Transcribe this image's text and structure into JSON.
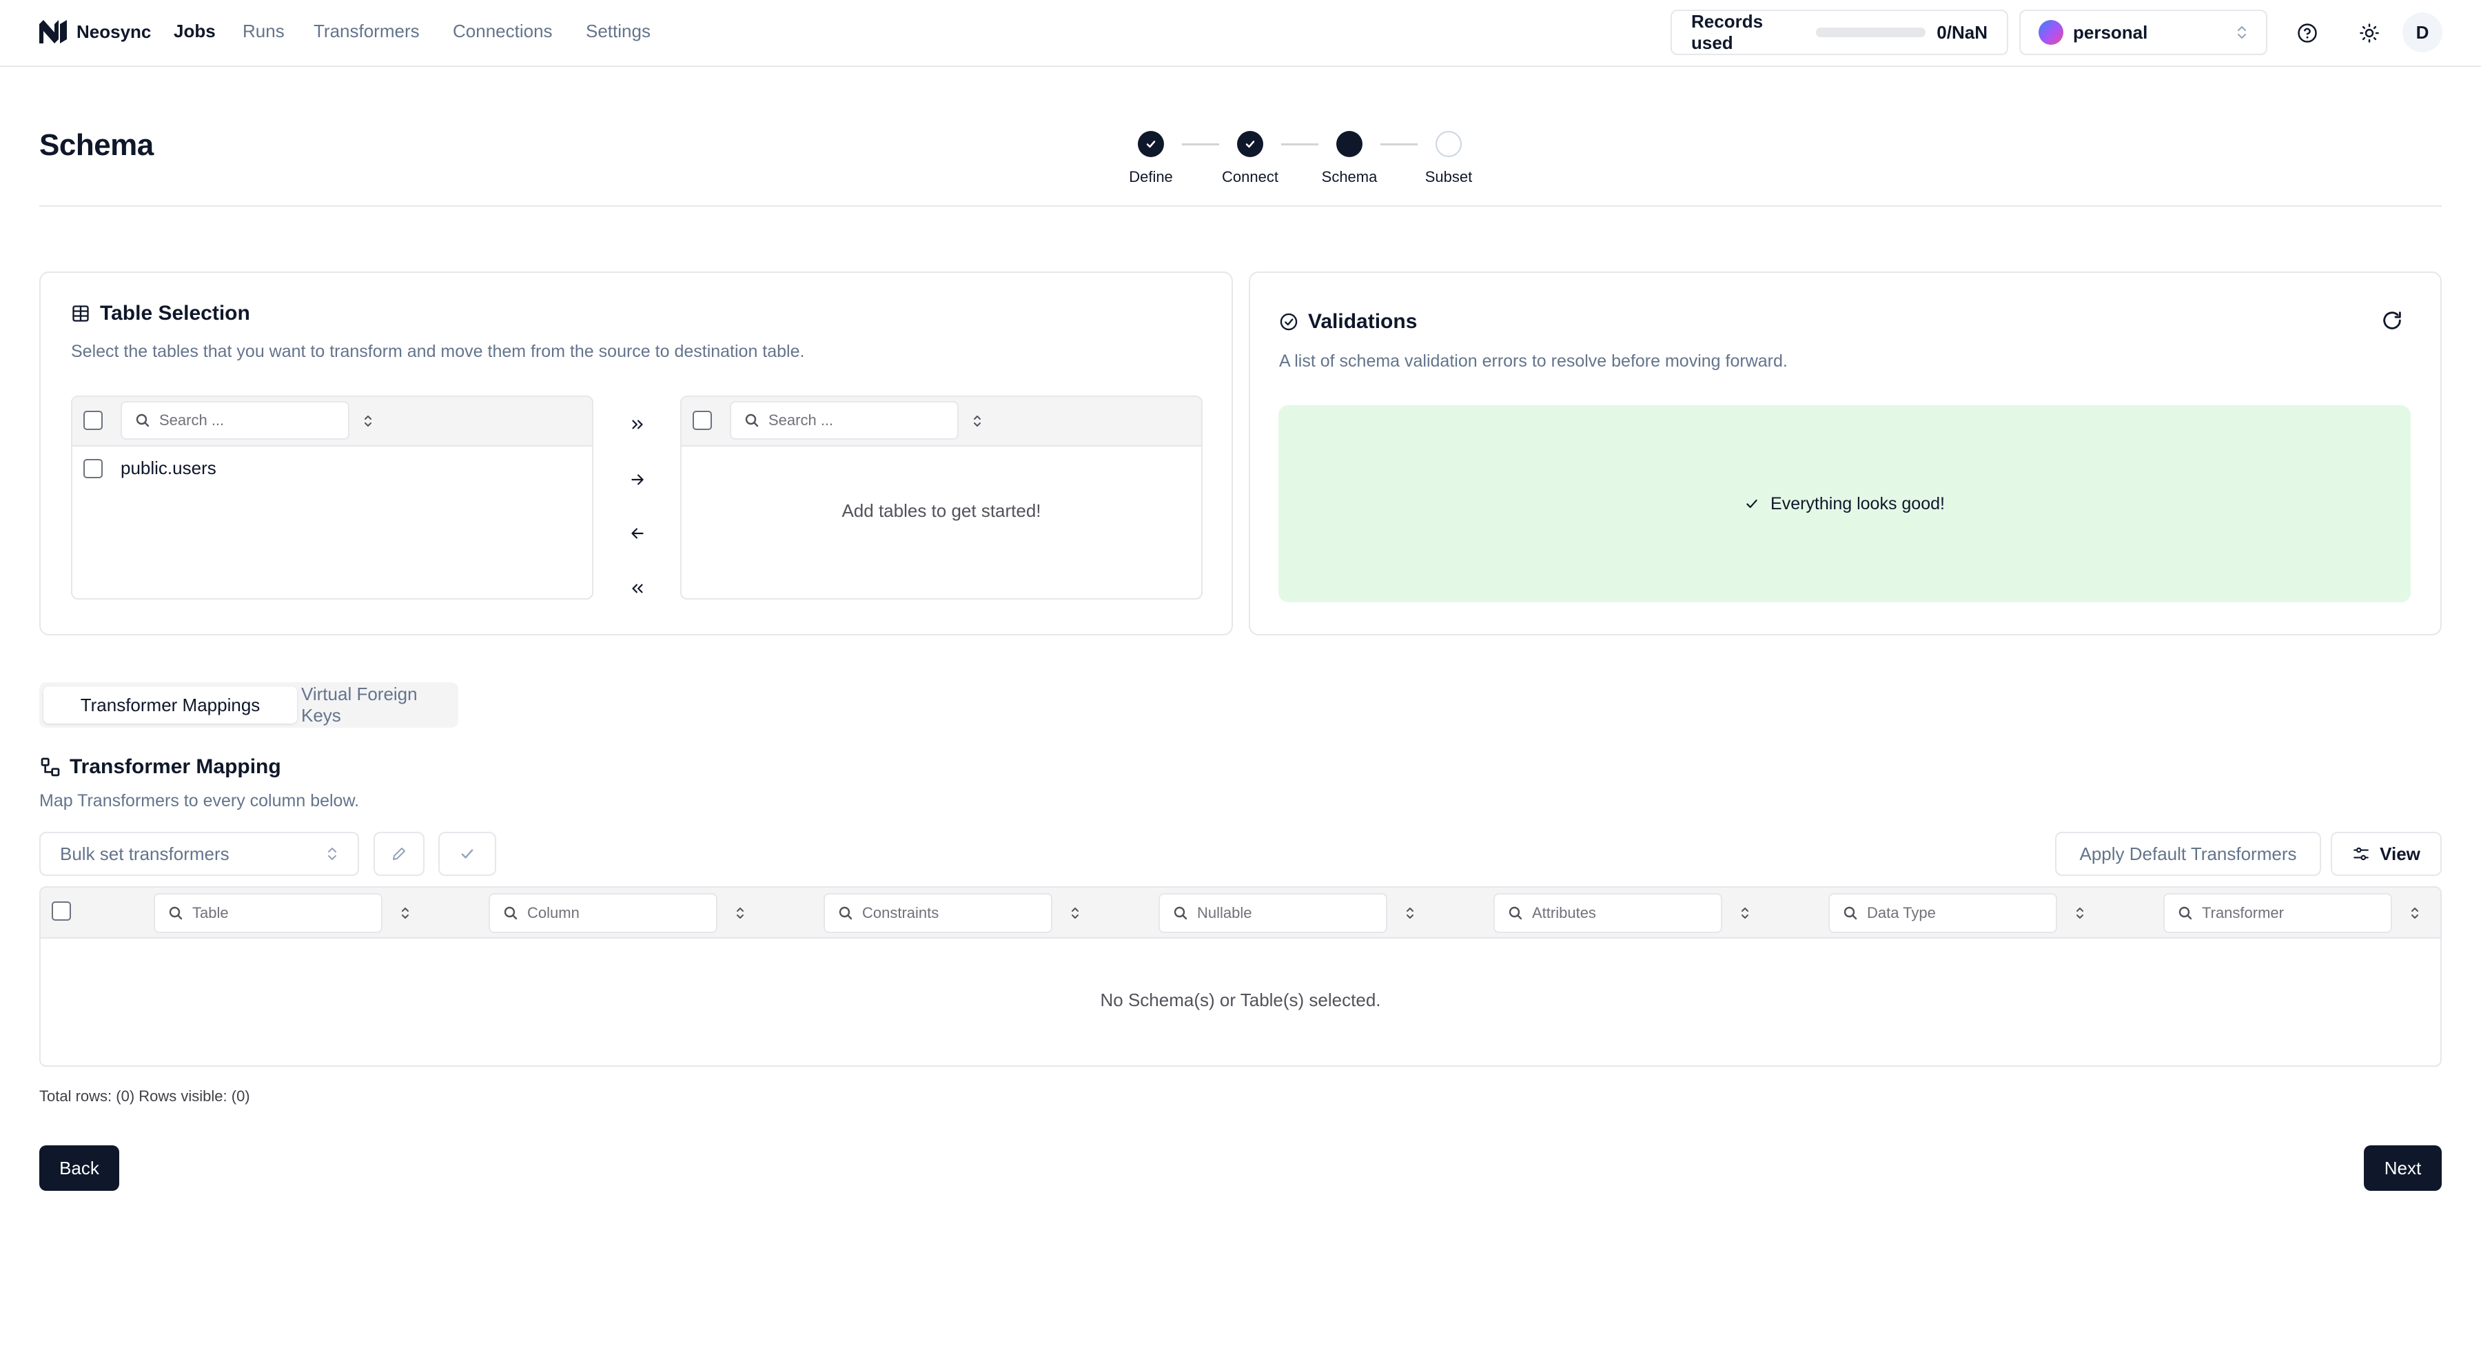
{
  "nav": {
    "brand": "Neosync",
    "links": [
      "Jobs",
      "Runs",
      "Transformers",
      "Connections",
      "Settings"
    ],
    "active_link": "Jobs"
  },
  "records": {
    "label": "Records used",
    "value": "0/NaN",
    "progress_fraction": 0
  },
  "account": {
    "name": "personal"
  },
  "user": {
    "initial": "D"
  },
  "page": {
    "title": "Schema"
  },
  "stepper": {
    "steps": [
      {
        "label": "Define",
        "state": "done"
      },
      {
        "label": "Connect",
        "state": "done"
      },
      {
        "label": "Schema",
        "state": "current"
      },
      {
        "label": "Subset",
        "state": "todo"
      }
    ]
  },
  "table_selection": {
    "title": "Table Selection",
    "description": "Select the tables that you want to transform and move them from the source to destination table.",
    "source": {
      "search_placeholder": "Search ...",
      "items": [
        "public.users"
      ]
    },
    "destination": {
      "search_placeholder": "Search ...",
      "empty_text": "Add tables to get started!"
    }
  },
  "validations": {
    "title": "Validations",
    "description": "A list of schema validation errors to resolve before moving forward.",
    "status_text": "Everything looks good!"
  },
  "tabs": {
    "items": [
      "Transformer Mappings",
      "Virtual Foreign Keys"
    ],
    "active": "Transformer Mappings"
  },
  "mapping": {
    "title": "Transformer Mapping",
    "description": "Map Transformers to every column below.",
    "bulk_placeholder": "Bulk set transformers",
    "apply_default_label": "Apply Default Transformers",
    "view_label": "View",
    "columns": [
      "Table",
      "Column",
      "Constraints",
      "Nullable",
      "Attributes",
      "Data Type",
      "Transformer"
    ],
    "empty_text": "No Schema(s) or Table(s) selected.",
    "footer": "Total rows: (0) Rows visible: (0)"
  },
  "actions": {
    "back_label": "Back",
    "next_label": "Next"
  },
  "colors": {
    "primary": "#0f172a",
    "success_bg": "#e3f9e6",
    "muted_text": "#64748b",
    "border": "#e5e7eb"
  }
}
